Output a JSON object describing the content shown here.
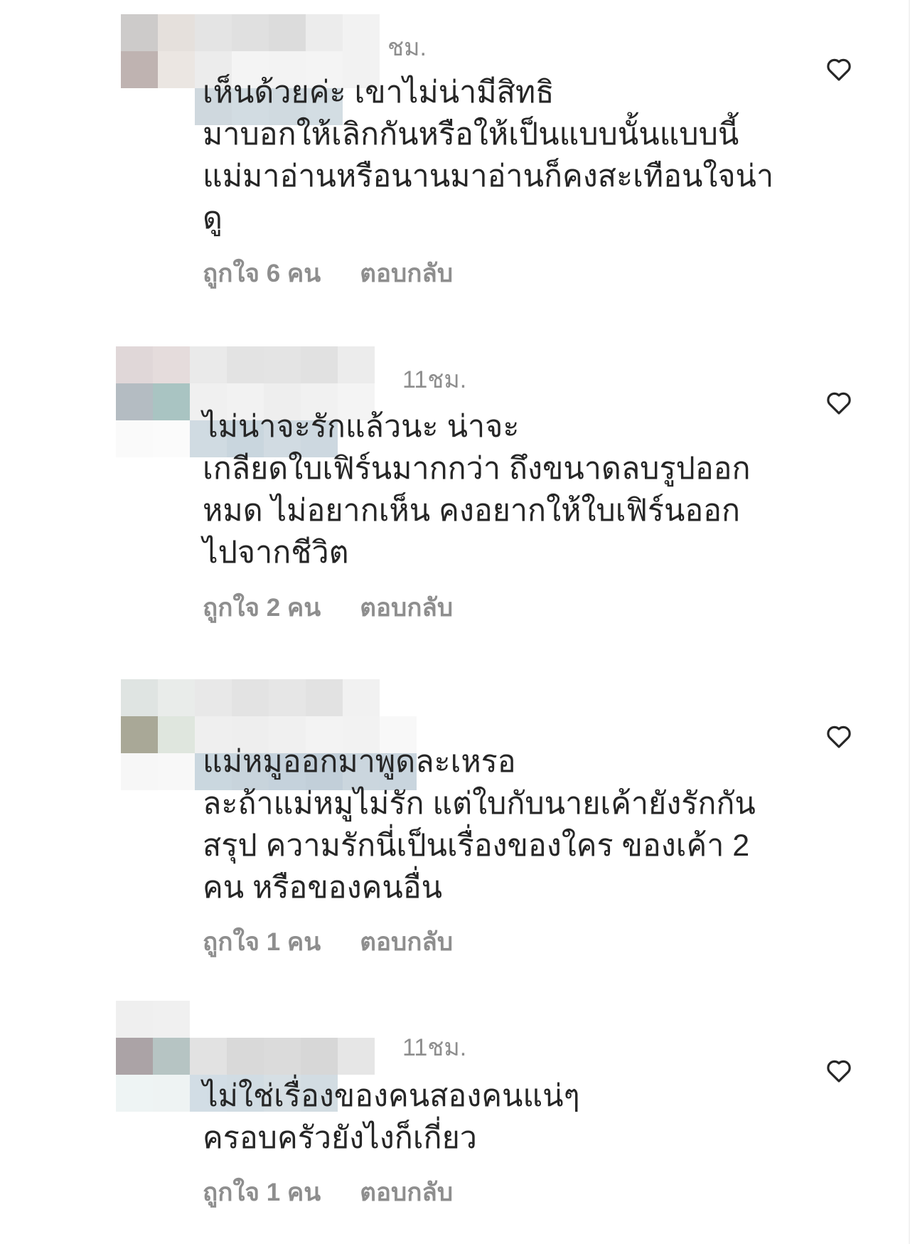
{
  "comments": [
    {
      "timestamp": "ชม.",
      "text": "เห็นด้วยค่ะ เขาไม่น่ามีสิทธิ\nมาบอกให้เลิกกันหรือให้เป็นแบบนั้นแบบนี้\nแม่มาอ่านหรือนานมาอ่านก็คงสะเทือนใจน่า\nดู",
      "likes": "ถูกใจ 6 คน",
      "reply": "ตอบกลับ",
      "like_icon": "heart-outline-icon"
    },
    {
      "timestamp": "11ชม.",
      "text": "ไม่น่าจะรักแล้วนะ น่าจะ\nเกลียดใบเฟิร์นมากกว่า ถึงขนาดลบรูปออก\nหมด ไม่อยากเห็น คงอยากให้ใบเฟิร์นออก\nไปจากชีวิต",
      "likes": "ถูกใจ 2 คน",
      "reply": "ตอบกลับ",
      "like_icon": "heart-outline-icon"
    },
    {
      "timestamp": "",
      "text": "แม่หมูออกมาพูดละเหรอ\nละถ้าแม่หมูไม่รัก แต่ใบกับนายเค้ายังรักกัน\nสรุป ความรักนี่เป็นเรื่องของใคร ของเค้า 2\nคน หรือของคนอื่น",
      "likes": "ถูกใจ 1 คน",
      "reply": "ตอบกลับ",
      "like_icon": "heart-outline-icon"
    },
    {
      "timestamp": "11ชม.",
      "text": "ไม่ใช่เรื่องของคนสองคนแน่ๆ\nครอบครัวยังไงก็เกี่ยว",
      "likes": "ถูกใจ 1 คน",
      "reply": "ตอบกลับ",
      "like_icon": "heart-outline-icon"
    }
  ],
  "colors": {
    "text": "#262626",
    "muted": "#8e8e8e",
    "heart": "#262626",
    "background": "#ffffff"
  }
}
